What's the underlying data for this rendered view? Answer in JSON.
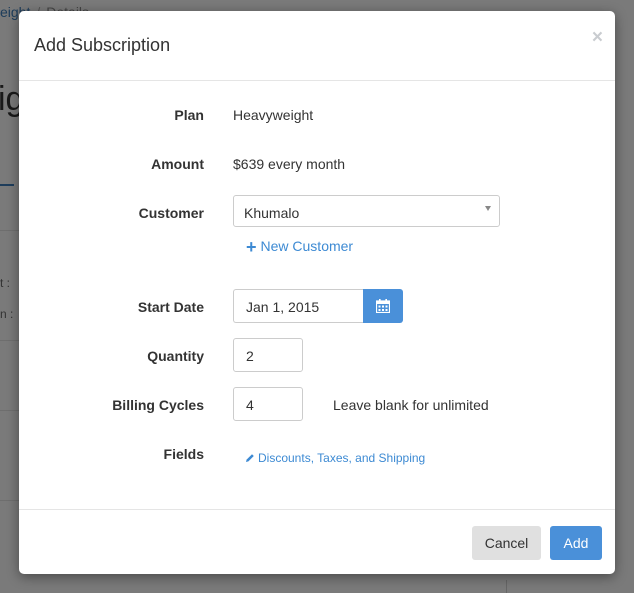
{
  "background": {
    "breadcrumb_parent": "eight",
    "breadcrumb_separator": "/",
    "breadcrumb_current": "Details",
    "title_fragment": "ig",
    "label_1": "t :",
    "label_2": "n :"
  },
  "modal": {
    "title": "Add Subscription",
    "close_label": "×",
    "fields": {
      "plan_label": "Plan",
      "plan_value": "Heavyweight",
      "amount_label": "Amount",
      "amount_value": "$639 every month",
      "customer_label": "Customer",
      "customer_value": "Khumalo",
      "new_customer_label": "New Customer",
      "start_date_label": "Start Date",
      "start_date_value": "Jan 1, 2015",
      "quantity_label": "Quantity",
      "quantity_value": "2",
      "billing_cycles_label": "Billing Cycles",
      "billing_cycles_value": "4",
      "billing_cycles_hint": "Leave blank for unlimited",
      "fields_label": "Fields",
      "fields_link": "Discounts, Taxes, and Shipping"
    },
    "footer": {
      "cancel_label": "Cancel",
      "add_label": "Add"
    }
  },
  "colors": {
    "primary": "#4a90d9",
    "link": "#3d8ad3",
    "cancel_bg": "#e0e0e0"
  }
}
